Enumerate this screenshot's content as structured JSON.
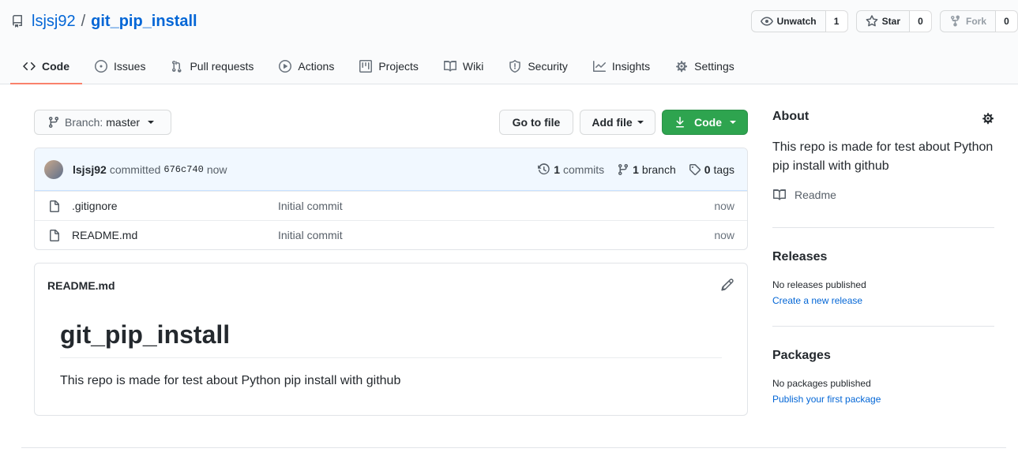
{
  "repo": {
    "owner": "lsjsj92",
    "separator": "/",
    "name": "git_pip_install"
  },
  "actions": {
    "unwatch": {
      "label": "Unwatch",
      "count": "1"
    },
    "star": {
      "label": "Star",
      "count": "0"
    },
    "fork": {
      "label": "Fork",
      "count": "0"
    }
  },
  "tabs": [
    {
      "label": "Code",
      "icon": "code-icon",
      "selected": true
    },
    {
      "label": "Issues",
      "icon": "issue-icon"
    },
    {
      "label": "Pull requests",
      "icon": "pull-request-icon"
    },
    {
      "label": "Actions",
      "icon": "play-icon"
    },
    {
      "label": "Projects",
      "icon": "project-icon"
    },
    {
      "label": "Wiki",
      "icon": "book-icon"
    },
    {
      "label": "Security",
      "icon": "shield-icon"
    },
    {
      "label": "Insights",
      "icon": "graph-icon"
    },
    {
      "label": "Settings",
      "icon": "gear-icon"
    }
  ],
  "toolbar": {
    "branch_prefix": "Branch:",
    "branch": "master",
    "go_to_file": "Go to file",
    "add_file": "Add file",
    "code": "Code"
  },
  "commit": {
    "user": "lsjsj92",
    "verb": "committed",
    "sha": "676c740",
    "time": "now",
    "commits_count": "1",
    "commits_label": "commits",
    "branch_count": "1",
    "branch_label": "branch",
    "tags_count": "0",
    "tags_label": "tags"
  },
  "files": [
    {
      "name": ".gitignore",
      "message": "Initial commit",
      "age": "now"
    },
    {
      "name": "README.md",
      "message": "Initial commit",
      "age": "now"
    }
  ],
  "readme": {
    "filename": "README.md",
    "heading": "git_pip_install",
    "body": "This repo is made for test about Python pip install with github"
  },
  "sidebar": {
    "about_title": "About",
    "about_desc": "This repo is made for test about Python pip install with github",
    "readme_link": "Readme",
    "releases_title": "Releases",
    "releases_none": "No releases published",
    "releases_link": "Create a new release",
    "packages_title": "Packages",
    "packages_none": "No packages published",
    "packages_link": "Publish your first package"
  },
  "colors": {
    "accent": "#0366d6",
    "tab_underline": "#f9826c",
    "code_button": "#2ea44f"
  }
}
